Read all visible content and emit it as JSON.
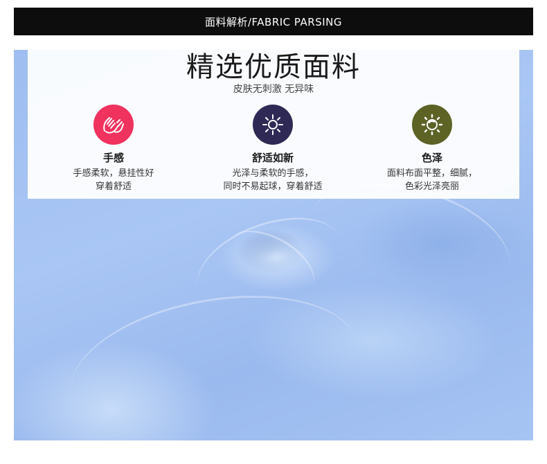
{
  "header": {
    "label": "面料解析/FABRIC PARSING"
  },
  "main": {
    "title": "精选优质面料",
    "subtitle": "皮肤无刺激 无异味"
  },
  "features": [
    {
      "icon": "hands-icon",
      "color": "#f0325f",
      "title": "手感",
      "desc_line1": "手感柔软，悬挂性好",
      "desc_line2": "穿着舒适"
    },
    {
      "icon": "sun-icon",
      "color": "#2e2a55",
      "title": "舒适如新",
      "desc_line1": "光泽与柔软的手感，",
      "desc_line2": "同时不易起球，穿着舒适"
    },
    {
      "icon": "shine-icon",
      "color": "#5c6325",
      "title": "色泽",
      "desc_line1": "面料布面平整，细腻，",
      "desc_line2": "色彩光泽亮丽"
    }
  ]
}
